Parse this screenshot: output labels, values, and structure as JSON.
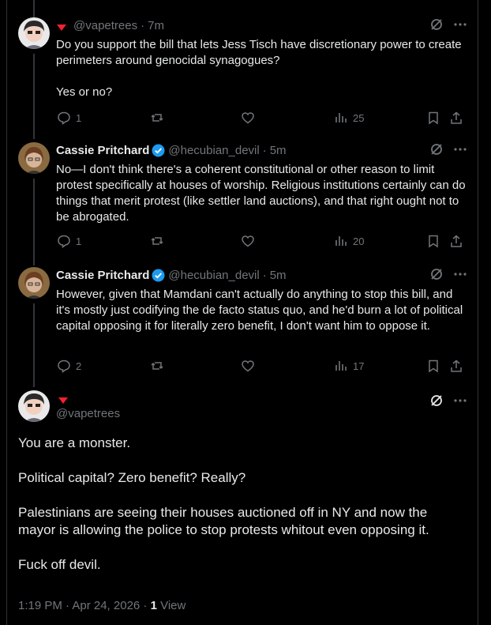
{
  "colors": {
    "background": "#000000",
    "text": "#e7e9ea",
    "muted": "#71767b",
    "verified": "#1d9bf0",
    "badge": "#f4212e",
    "divider": "#2f3336"
  },
  "replies": [
    {
      "display_name": "",
      "handle": "@vapetrees",
      "time": "7m",
      "verified": false,
      "paragraphs": [
        "Do you support the bill that lets Jess Tisch have discretionary power to create perimeters around genocidal synagogues?",
        "Yes or no?"
      ],
      "stats": {
        "replies": "1",
        "reposts": "",
        "likes": "",
        "views": "25"
      }
    },
    {
      "display_name": "Cassie Pritchard",
      "handle": "@hecubian_devil",
      "time": "5m",
      "verified": true,
      "paragraphs": [
        "No—I don't think there's a coherent constitutional or other reason to limit protest specifically at houses of worship. Religious institutions certainly can do things that merit protest (like settler land auctions), and that right ought not to be abrogated."
      ],
      "stats": {
        "replies": "1",
        "reposts": "",
        "likes": "",
        "views": "20"
      }
    },
    {
      "display_name": "Cassie Pritchard",
      "handle": "@hecubian_devil",
      "time": "5m",
      "verified": true,
      "paragraphs": [
        "However, given that Mamdani can't actually do anything to stop this bill, and it's mostly just codifying the de facto status quo, and he'd burn a lot of political capital opposing it for literally zero benefit, I don't want him to oppose it."
      ],
      "stats": {
        "replies": "2",
        "reposts": "",
        "likes": "",
        "views": "17"
      }
    }
  ],
  "main_post": {
    "handle": "@vapetrees",
    "paragraphs": [
      "You are a monster.",
      "Political capital? Zero benefit? Really?",
      "Palestinians are seeing their houses auctioned off in NY and now the mayor is allowing the police to stop protests whitout even opposing it.",
      "Fuck off devil."
    ],
    "timestamp": "1:19 PM · Apr 24, 2026 · ",
    "views_count": "1",
    "views_label": " View"
  },
  "separator": "·"
}
